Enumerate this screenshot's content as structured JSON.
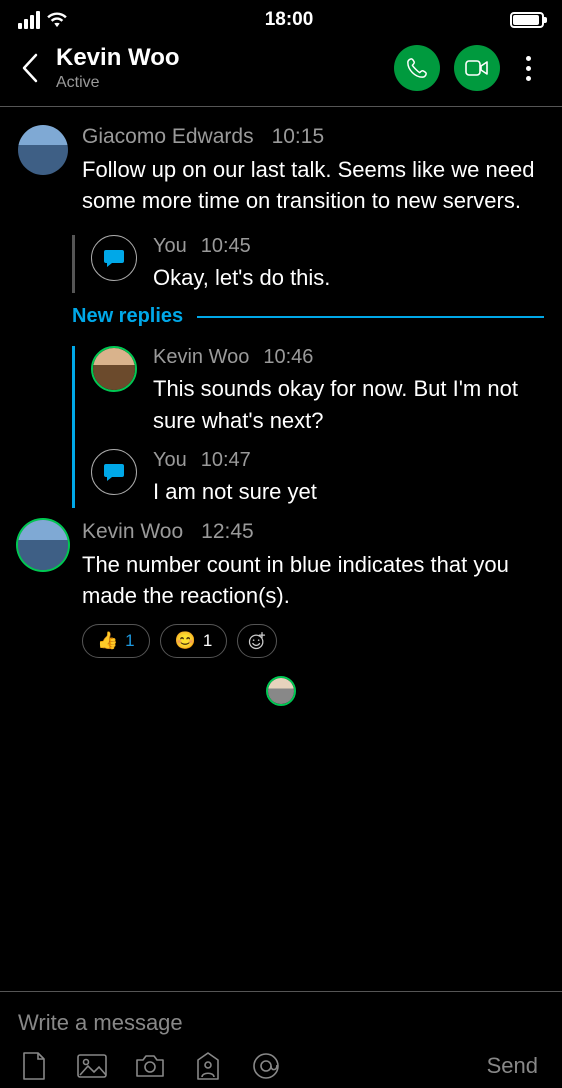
{
  "status": {
    "time": "18:00"
  },
  "header": {
    "name": "Kevin Woo",
    "presence": "Active"
  },
  "messages": [
    {
      "sender": "Giacomo Edwards",
      "time": "10:15",
      "text": "Follow up on our last talk. Seems like we need some more time on transition to new servers.",
      "thread_old": [
        {
          "sender": "You",
          "time": "10:45",
          "text": "Okay, let's do this."
        }
      ],
      "new_replies_label": "New replies",
      "thread_new": [
        {
          "sender": "Kevin Woo",
          "time": "10:46",
          "text": "This sounds okay for now. But I'm not sure what's next?"
        },
        {
          "sender": "You",
          "time": "10:47",
          "text": "I am not sure yet"
        }
      ]
    },
    {
      "sender": "Kevin Woo",
      "time": "12:45",
      "text": "The number count in blue indicates that you made the reaction(s).",
      "reactions": [
        {
          "emoji": "👍",
          "count": "1",
          "mine": true
        },
        {
          "emoji": "😊",
          "count": "1",
          "mine": false
        }
      ]
    }
  ],
  "composer": {
    "placeholder": "Write a message",
    "send_label": "Send"
  }
}
